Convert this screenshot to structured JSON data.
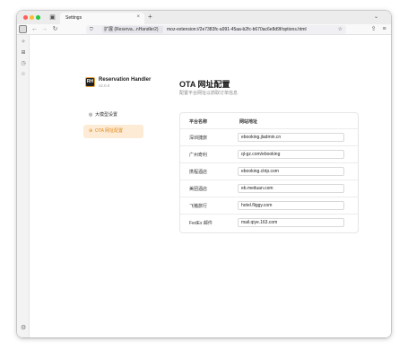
{
  "browser": {
    "tab_title": "Settings",
    "tab_close": "×",
    "new_tab": "+",
    "tab_list": "⌄",
    "back": "←",
    "forward": "→",
    "reload": "↻",
    "shield": "⛉",
    "ext_icon": "🧩",
    "ext_label": "扩展 (Reserva...nHandler2)",
    "url": "moz-extension://2e7383fc-a991-45aa-b2fc-b670ac6e8d9f/options.html",
    "bookmark": "☆",
    "share": "⇪",
    "menu": "≡"
  },
  "sidebar_rail": {
    "icons": [
      "✧",
      "⊞",
      "◷",
      "☆"
    ],
    "settings": "⚙"
  },
  "app": {
    "logo_text": "RH",
    "name": "Reservation Handler",
    "version": "v2.0.0"
  },
  "menu": {
    "items": [
      {
        "icon": "◎",
        "label": "大模型设置"
      },
      {
        "icon": "⊕",
        "label": "OTA 网址配置"
      }
    ]
  },
  "page": {
    "title": "OTA 网址配置",
    "subtitle": "配置平台网址以抓取订单信息"
  },
  "table": {
    "headers": [
      "平台名称",
      "网站地址"
    ],
    "rows": [
      {
        "name": "深圳捷旅",
        "url": "ebooking.jladmin.cn"
      },
      {
        "name": "广州奇利",
        "url": "ql-gz.com/ebooking"
      },
      {
        "name": "携程酒店",
        "url": "ebooking.ctrip.com"
      },
      {
        "name": "美团酒店",
        "url": "eb.meituan.com"
      },
      {
        "name": "飞猪旅行",
        "url": "hotel.fliggy.com"
      },
      {
        "name": "FedEx 邮件",
        "url": "mail.qiye.163.com"
      }
    ]
  }
}
